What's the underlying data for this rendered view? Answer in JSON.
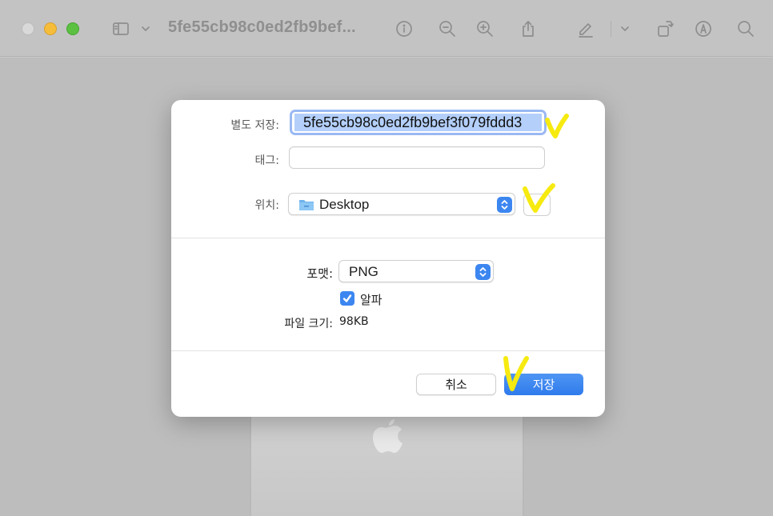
{
  "window": {
    "title": "5fe55cb98c0ed2fb9bef...",
    "toolbar_icons": [
      "sidebar-icon",
      "chevron-down-icon",
      "info-icon",
      "zoom-out-icon",
      "zoom-in-icon",
      "share-icon",
      "markup-pen-icon",
      "chevron-down-icon",
      "rotate-icon",
      "annotate-icon",
      "search-icon"
    ]
  },
  "dialog": {
    "save_as_label": "별도 저장:",
    "save_as_value": "5fe55cb98c0ed2fb9bef3f079fddd3",
    "tags_label": "태그:",
    "tags_value": "",
    "location_label": "위치:",
    "location_value": "Desktop",
    "format_label": "포맷:",
    "format_value": "PNG",
    "alpha_label": "알파",
    "alpha_checked": true,
    "filesize_label": "파일 크기:",
    "filesize_value": "98KB",
    "cancel_label": "취소",
    "save_label": "저장"
  },
  "colors": {
    "accent": "#3c86f0",
    "annotation": "#f6ea10",
    "selection": "#b3cffa"
  }
}
